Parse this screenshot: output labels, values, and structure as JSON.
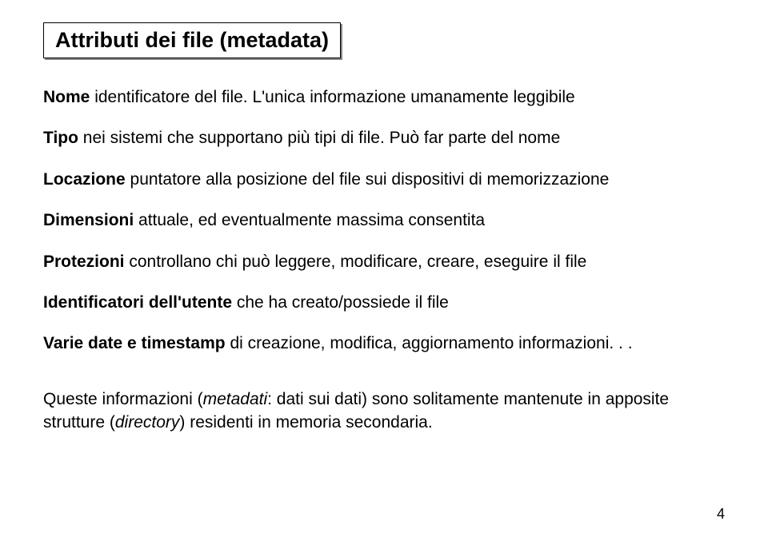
{
  "title": "Attributi dei file (metadata)",
  "items": [
    {
      "label": "Nome",
      "text": " identificatore del file. L'unica informazione umanamente leggibile"
    },
    {
      "label": "Tipo",
      "text": " nei sistemi che supportano più tipi di file. Può far parte del nome"
    },
    {
      "label": "Locazione",
      "text": " puntatore alla posizione del file sui dispositivi di memorizzazione"
    },
    {
      "label": "Dimensioni",
      "text": " attuale, ed eventualmente massima consentita"
    },
    {
      "label": "Protezioni",
      "text": " controllano chi può leggere, modificare, creare, eseguire il file"
    },
    {
      "label": "Identificatori dell'utente",
      "text": " che ha creato/possiede il file"
    },
    {
      "label": "Varie date e timestamp",
      "text": " di creazione, modifica, aggiornamento informazioni. . ."
    }
  ],
  "footer_text_a": "Queste informazioni (",
  "footer_italic": "metadati",
  "footer_text_b": ": dati sui dati) sono solitamente mantenute in apposite strutture (",
  "footer_italic2": "directory",
  "footer_text_c": ") residenti in memoria secondaria.",
  "page_number": "4"
}
